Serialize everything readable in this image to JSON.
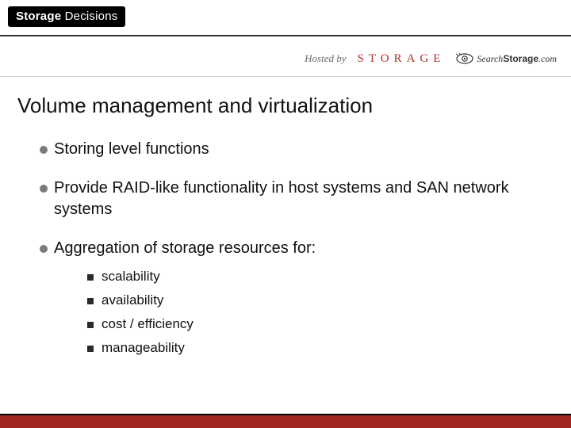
{
  "brand": {
    "word1": "Storage",
    "word2": "Decisions"
  },
  "hosted": {
    "label": "Hosted by",
    "storage_logo": "STORAGE",
    "search_storage": {
      "search": "Search",
      "storage": "Storage",
      "suffix": ".com"
    }
  },
  "title": "Volume management and virtualization",
  "bullets": [
    {
      "text": "Storing level functions"
    },
    {
      "text": "Provide RAID-like functionality in host systems and SAN network systems"
    },
    {
      "text": "Aggregation of storage resources for:",
      "sub": [
        "scalability",
        "availability",
        "cost / efficiency",
        "manageability"
      ]
    }
  ]
}
